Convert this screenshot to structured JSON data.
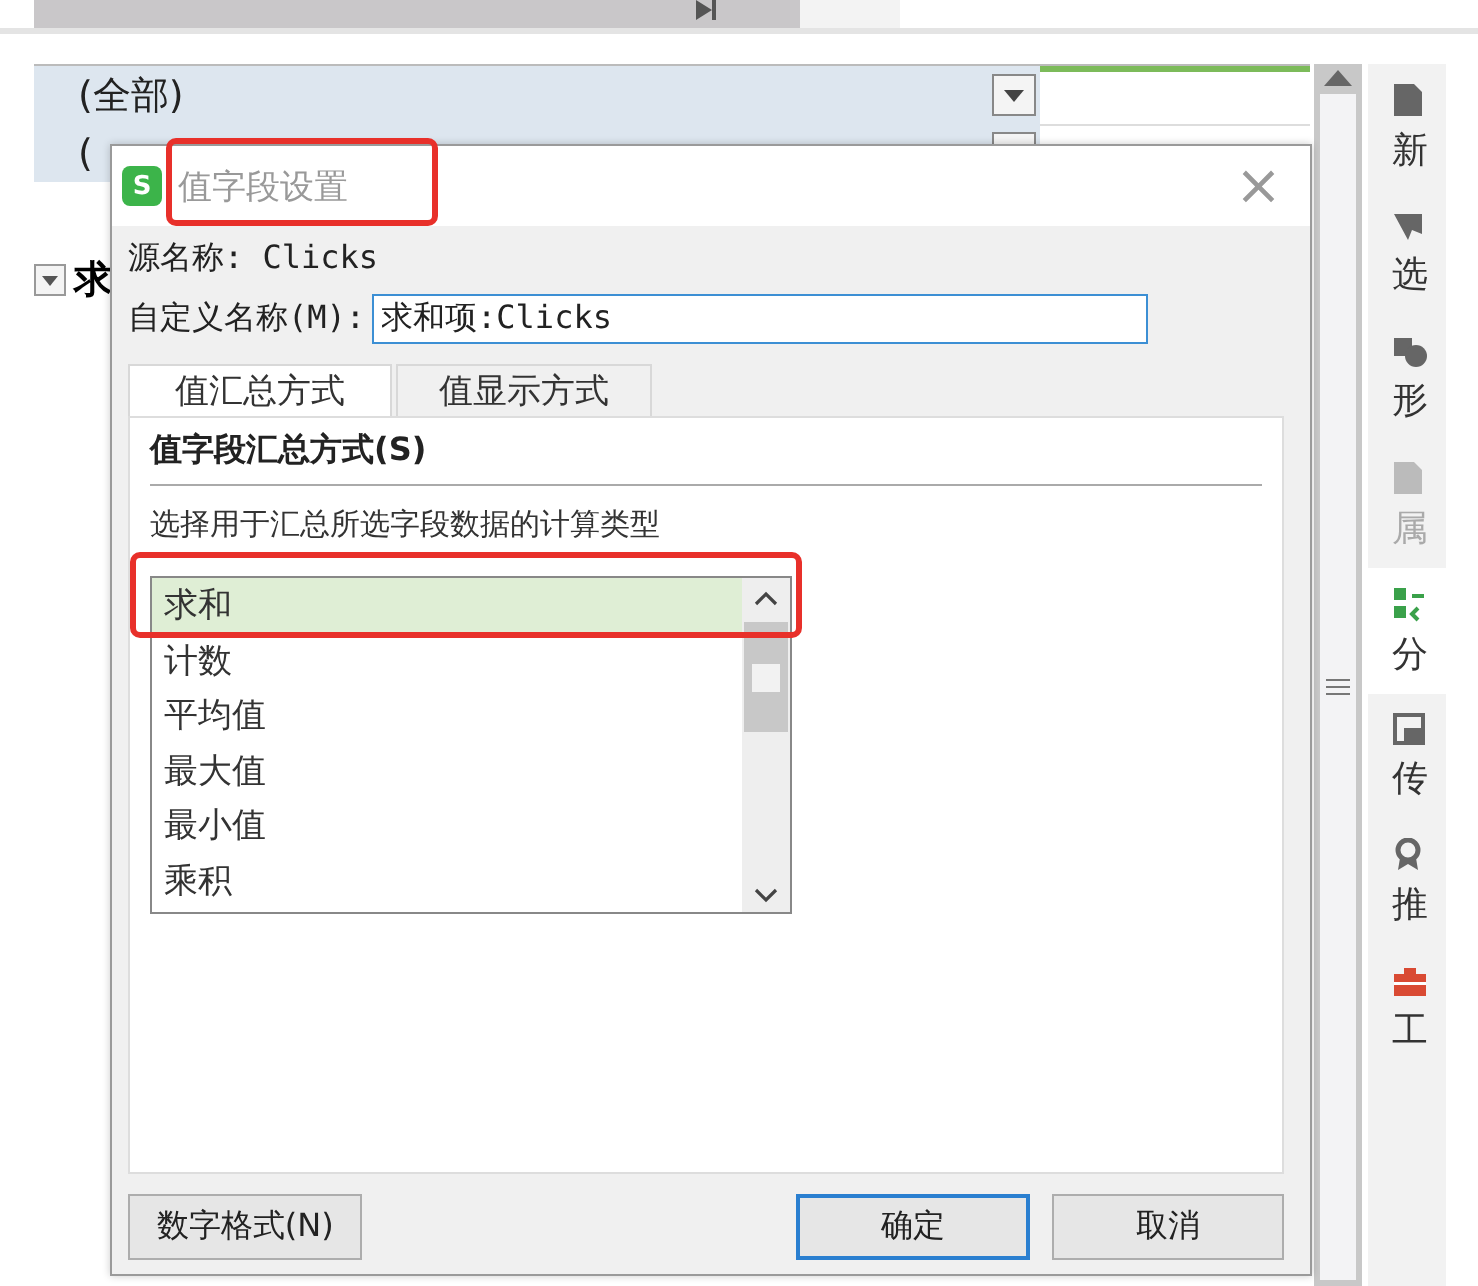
{
  "sheet": {
    "filter_rows": [
      {
        "label": "(全部)"
      },
      {
        "label": "("
      }
    ],
    "row_label": "求"
  },
  "side_panel": {
    "items": [
      {
        "label": "新",
        "kind": "doc",
        "selected": false,
        "disabled": false
      },
      {
        "label": "选",
        "kind": "cursor",
        "selected": false,
        "disabled": false
      },
      {
        "label": "形",
        "kind": "shape",
        "selected": false,
        "disabled": false
      },
      {
        "label": "属",
        "kind": "doc",
        "selected": false,
        "disabled": true
      },
      {
        "label": "分",
        "kind": "pivot",
        "selected": true,
        "disabled": false
      },
      {
        "label": "传",
        "kind": "frame",
        "selected": false,
        "disabled": false
      },
      {
        "label": "推",
        "kind": "badge",
        "selected": false,
        "disabled": false
      },
      {
        "label": "工",
        "kind": "toolbox",
        "selected": false,
        "disabled": false
      }
    ]
  },
  "dialog": {
    "app_badge": "S",
    "title": "值字段设置",
    "title_marked": true,
    "close": "×",
    "source_name": "源名称: Clicks",
    "custom_name_label": "自定义名称(M):",
    "custom_name_value": "求和项:Clicks",
    "tabs": [
      {
        "label": "值汇总方式",
        "selected": true
      },
      {
        "label": "值显示方式",
        "selected": false
      }
    ],
    "section_title": "值字段汇总方式(S)",
    "hint": "选择用于汇总所选字段数据的计算类型",
    "functions": [
      {
        "label": "求和",
        "selected": true,
        "marked": true
      },
      {
        "label": "计数",
        "selected": false,
        "marked": false
      },
      {
        "label": "平均值",
        "selected": false,
        "marked": false
      },
      {
        "label": "最大值",
        "selected": false,
        "marked": false
      },
      {
        "label": "最小值",
        "selected": false,
        "marked": false
      },
      {
        "label": "乘积",
        "selected": false,
        "marked": false
      }
    ],
    "buttons": [
      {
        "label": "数字格式(N)",
        "kind": "side",
        "default": false
      },
      {
        "label": "确定",
        "kind": "main",
        "default": true
      },
      {
        "label": "取消",
        "kind": "main",
        "default": false
      }
    ]
  }
}
